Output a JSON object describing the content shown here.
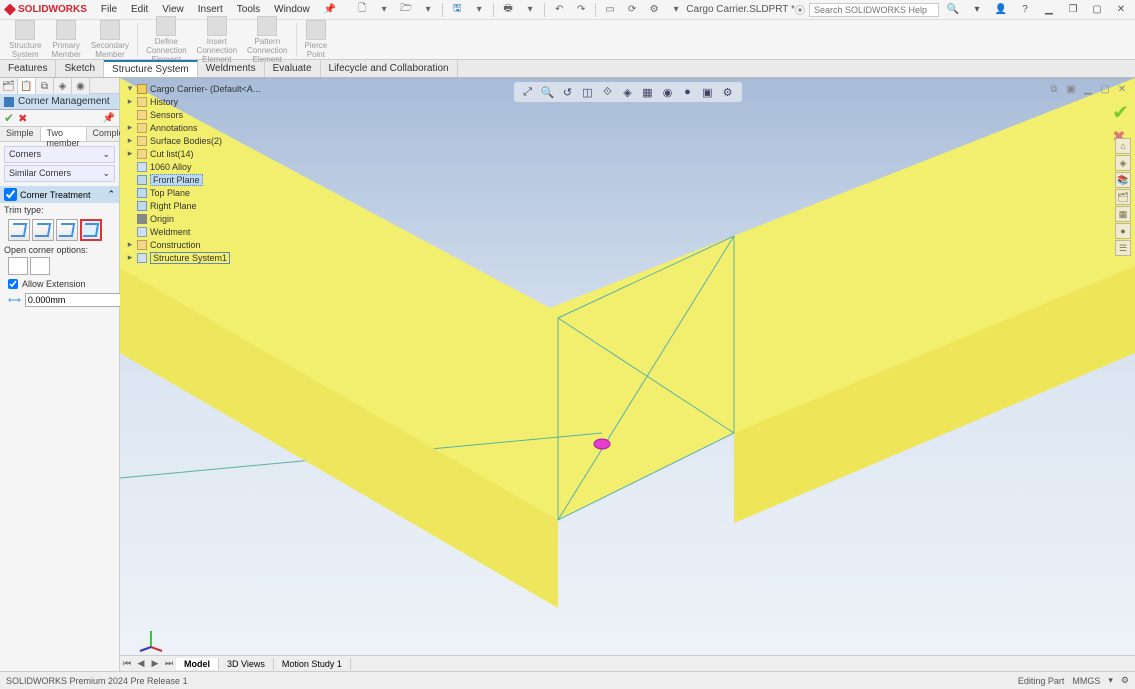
{
  "app": {
    "brand": "SOLIDWORKS",
    "doc_title": "Cargo Carrier.SLDPRT *",
    "search_placeholder": "Search SOLIDWORKS Help"
  },
  "menu": {
    "file": "File",
    "edit": "Edit",
    "view": "View",
    "insert": "Insert",
    "tools": "Tools",
    "window": "Window"
  },
  "ribbon": {
    "structure_system": "Structure\nSystem",
    "primary_member": "Primary\nMember",
    "secondary_member": "Secondary\nMember",
    "define_connection": "Define\nConnection\nElement",
    "insert_connection": "Insert\nConnection\nElement",
    "pattern_connection": "Pattern\nConnection\nElement",
    "pierce_point": "Pierce\nPoint"
  },
  "tabs": {
    "features": "Features",
    "sketch": "Sketch",
    "structure_system": "Structure System",
    "weldments": "Weldments",
    "evaluate": "Evaluate",
    "lifecycle": "Lifecycle and Collaboration"
  },
  "pm": {
    "title": "Corner Management",
    "sub_simple": "Simple",
    "sub_two": "Two member",
    "sub_complex": "Complex",
    "corners": "Corners",
    "similar": "Similar Corners",
    "treatment": "Corner Treatment",
    "trim_type": "Trim type:",
    "open_options": "Open corner options:",
    "allow_ext": "Allow Extension",
    "gap_value": "0.000mm"
  },
  "tree": {
    "root": "Cargo Carrier- (Default<A...",
    "history": "History",
    "sensors": "Sensors",
    "annotations": "Annotations",
    "surface_bodies": "Surface Bodies(2)",
    "cutlist": "Cut list(14)",
    "alloy": "1060 Alloy",
    "front": "Front Plane",
    "top": "Top Plane",
    "right": "Right Plane",
    "origin": "Origin",
    "weldment": "Weldment",
    "construction": "Construction",
    "ss1": "Structure System1"
  },
  "bottom_tabs": {
    "model": "Model",
    "views3d": "3D Views",
    "motion": "Motion Study 1"
  },
  "status": {
    "version": "SOLIDWORKS Premium 2024 Pre Release 1",
    "editing": "Editing Part",
    "units": "MMGS"
  }
}
